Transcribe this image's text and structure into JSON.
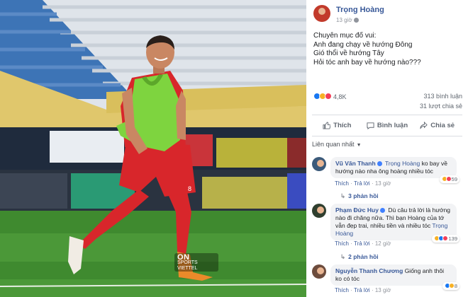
{
  "photo": {
    "watermark_logo": "ON",
    "watermark_sub": "SPORTS",
    "watermark_brand": "VIETTEL"
  },
  "post": {
    "author": "Trọng Hoàng",
    "time": "13 giờ",
    "lines": [
      "Chuyên mục đố vui:",
      "Anh đang chạy về hướng Đông",
      "Gió thổi về hướng Tây",
      "Hỏi tóc anh bay về hướng nào???"
    ],
    "reaction_count": "4,8K",
    "comments_count": "313 bình luận",
    "shares_count": "31 lượt chia sẻ"
  },
  "actions": {
    "like": "Thích",
    "comment": "Bình luận",
    "share": "Chia sẻ"
  },
  "filter": {
    "label": "Liên quan nhất"
  },
  "comments": [
    {
      "author": "Vũ Văn Thanh",
      "mention": "Trọng Hoàng",
      "text": "ko bay về hướng nào nha ông hoàng nhiều tóc",
      "reactions": "59",
      "like": "Thích",
      "reply": "Trả lời",
      "time": "13 giờ",
      "replies": "3 phản hồi"
    },
    {
      "author": "Phạm Đức Huy",
      "text": "Dù câu trả lời là hướng nào đi chăng nữa. Thì bạn Hoàng của tớ vẫn đẹp trai, nhiều tiền và nhiều tóc",
      "mention": "Trọng Hoàng",
      "reactions": "139",
      "like": "Thích",
      "reply": "Trả lời",
      "time": "12 giờ",
      "replies": "2 phản hồi"
    },
    {
      "author": "Nguyễn Thanh Chương",
      "text": "Giống anh thôi ko có tóc",
      "reactions": "8",
      "like": "Thích",
      "reply": "Trả lời",
      "time": "13 giờ"
    }
  ],
  "colors": {
    "link": "#385898",
    "meta": "#90949c",
    "bubble": "#f2f3f5",
    "jersey": "#d8262b",
    "bib": "#7ed43f",
    "pitch": "#3f8a2f"
  }
}
